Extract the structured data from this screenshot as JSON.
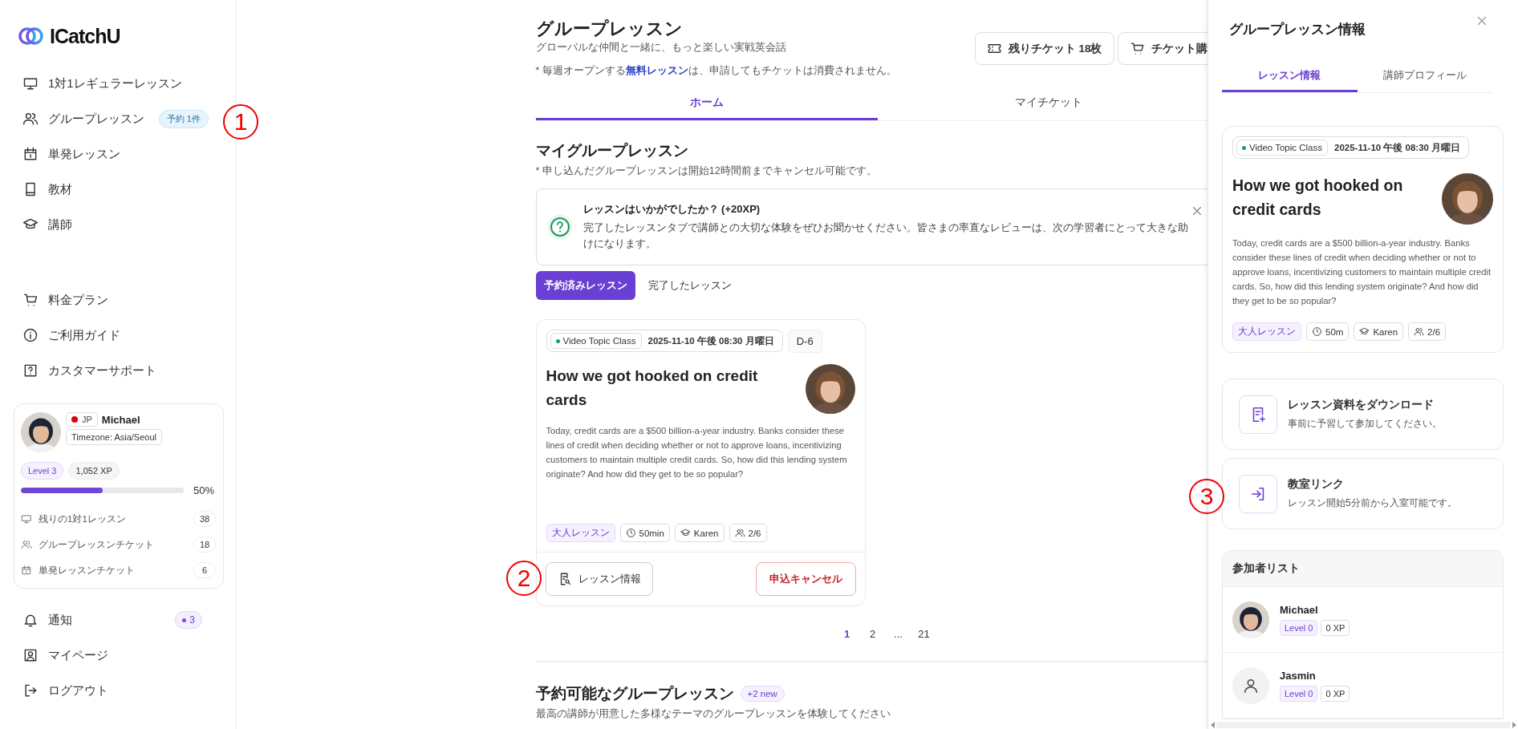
{
  "sidebar": {
    "logo": "ICatchU",
    "nav": [
      {
        "label": "1対1レギュラーレッスン"
      },
      {
        "label": "グループレッスン",
        "badge": "予約 1件"
      },
      {
        "label": "単発レッスン"
      },
      {
        "label": "教材"
      },
      {
        "label": "講師"
      }
    ],
    "nav_secondary": [
      {
        "label": "料金プラン"
      },
      {
        "label": "ご利用ガイド"
      },
      {
        "label": "カスタマーサポート"
      }
    ],
    "profile": {
      "country": "JP",
      "name": "Michael",
      "timezone": "Timezone: Asia/Seoul",
      "level": "Level 3",
      "xp": "1,052 XP",
      "progress": {
        "level": 0.5,
        "reading": "50%"
      },
      "stats": [
        {
          "label": "残りの1対1レッスン",
          "count": "38"
        },
        {
          "label": "グループレッスンチケット",
          "count": "18"
        },
        {
          "label": "単発レッスンチケット",
          "count": "6"
        }
      ]
    },
    "nav_footer": [
      {
        "label": "通知",
        "badge": "3"
      },
      {
        "label": "マイページ"
      },
      {
        "label": "ログアウト"
      }
    ]
  },
  "main": {
    "title": "グループレッスン",
    "subtitle": "グローバルな仲間と一緒に、もっと楽しい実戦英会話",
    "notice": "* 毎週オープンする**無料レッスン**は、申請してもチケットは消費されません。",
    "header_buttons": [
      {
        "label": "残りチケット 18枚"
      },
      {
        "label": "チケット購"
      }
    ],
    "tabs": [
      {
        "label": "ホーム",
        "selected": true
      },
      {
        "label": "マイチケット",
        "selected": false
      }
    ],
    "my_section": {
      "title": "マイグループレッスン",
      "note": "* 申し込んだグループレッスンは開始12時間前までキャンセル可能です。",
      "feedback": {
        "title": "レッスンはいかがでしたか？ (+20XP)",
        "text": "完了したレッスンタブで講師との大切な体験をぜひお聞かせください。皆さまの率直なレビューは、次の学習者にとって大きな助けになります。"
      },
      "filters": [
        {
          "label": "予約済みレッスン",
          "selected": true
        },
        {
          "label": "完了したレッスン",
          "selected": false
        }
      ],
      "lesson": {
        "class_type": "Video Topic Class",
        "datetime": "2025-11-10 午後 08:30 月曜日",
        "countdown": "D-6",
        "title": "How we got hooked on credit cards",
        "description": "Today, credit cards are a $500 billion-a-year industry. Banks consider these lines of credit when deciding whether or not to approve loans, incentivizing customers to maintain multiple credit cards. So, how did this lending system originate? And how did they get to be so popular?",
        "tags": [
          {
            "kind": "category",
            "label": "大人レッスン"
          },
          {
            "kind": "duration",
            "label": "50min"
          },
          {
            "kind": "teacher",
            "label": "Karen"
          },
          {
            "kind": "capacity",
            "label": "2/6"
          }
        ],
        "info_button": "レッスン情報",
        "cancel_button": "申込キャンセル"
      },
      "pagination": [
        {
          "label": "1",
          "selected": true
        },
        {
          "label": "2",
          "selected": false
        },
        {
          "label": "...",
          "selected": false
        },
        {
          "label": "21",
          "selected": false
        }
      ]
    },
    "available": {
      "title": "予約可能なグループレッスン",
      "badge": "+2 new",
      "subtitle": "最高の講師が用意した多様なテーマのグループレッスンを体験してください"
    }
  },
  "drawer": {
    "title": "グループレッスン情報",
    "tabs": [
      {
        "label": "レッスン情報",
        "selected": true
      },
      {
        "label": "講師プロフィール",
        "selected": false
      }
    ],
    "lesson": {
      "class_type": "Video Topic Class",
      "datetime": "2025-11-10 午後 08:30 月曜日",
      "title": "How we got hooked on credit cards",
      "description": "Today, credit cards are a $500 billion-a-year industry. Banks consider these lines of credit when deciding whether or not to approve loans, incentivizing customers to maintain multiple credit cards. So, how did this lending system originate? And how did they get to be so popular?",
      "tags": [
        {
          "kind": "category",
          "label": "大人レッスン"
        },
        {
          "kind": "duration",
          "label": "50m"
        },
        {
          "kind": "teacher",
          "label": "Karen"
        },
        {
          "kind": "capacity",
          "label": "2/6"
        }
      ]
    },
    "resources": [
      {
        "kind": "download",
        "title": "レッスン資料をダウンロード",
        "text": "事前に予習して参加してください。"
      },
      {
        "kind": "link",
        "title": "教室リンク",
        "text": "レッスン開始5分前から入室可能です。"
      }
    ],
    "participants": {
      "title": "参加者リスト",
      "people": [
        {
          "name": "Michael",
          "level": "Level 0",
          "xp": "0 XP"
        },
        {
          "name": "Jasmin",
          "kind": "placeholder",
          "level": "Level 0",
          "xp": "0 XP"
        }
      ]
    }
  },
  "annotations": [
    {
      "label": "1"
    },
    {
      "label": "2"
    },
    {
      "label": "3"
    }
  ]
}
